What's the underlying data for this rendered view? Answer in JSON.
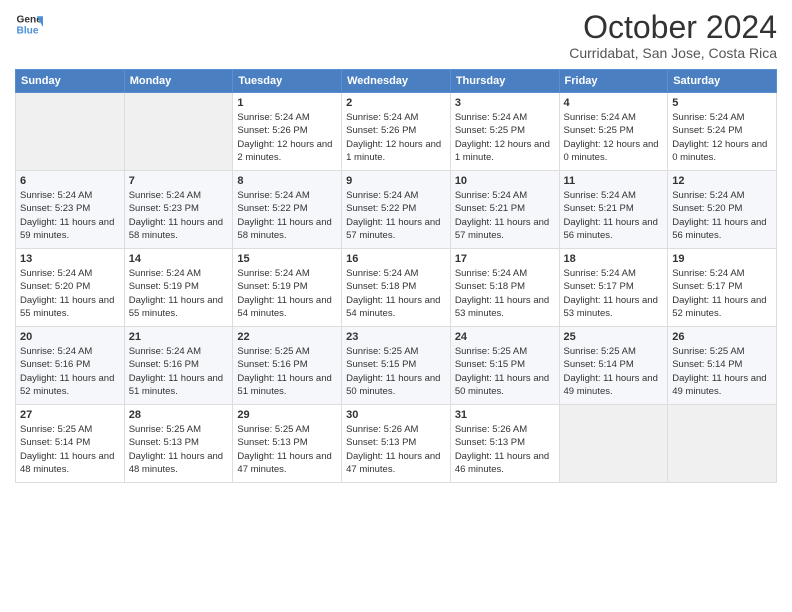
{
  "logo": {
    "line1": "General",
    "line2": "Blue"
  },
  "title": "October 2024",
  "subtitle": "Curridabat, San Jose, Costa Rica",
  "days_of_week": [
    "Sunday",
    "Monday",
    "Tuesday",
    "Wednesday",
    "Thursday",
    "Friday",
    "Saturday"
  ],
  "weeks": [
    [
      {
        "day": "",
        "info": ""
      },
      {
        "day": "",
        "info": ""
      },
      {
        "day": "1",
        "info": "Sunrise: 5:24 AM\nSunset: 5:26 PM\nDaylight: 12 hours and 2 minutes."
      },
      {
        "day": "2",
        "info": "Sunrise: 5:24 AM\nSunset: 5:26 PM\nDaylight: 12 hours and 1 minute."
      },
      {
        "day": "3",
        "info": "Sunrise: 5:24 AM\nSunset: 5:25 PM\nDaylight: 12 hours and 1 minute."
      },
      {
        "day": "4",
        "info": "Sunrise: 5:24 AM\nSunset: 5:25 PM\nDaylight: 12 hours and 0 minutes."
      },
      {
        "day": "5",
        "info": "Sunrise: 5:24 AM\nSunset: 5:24 PM\nDaylight: 12 hours and 0 minutes."
      }
    ],
    [
      {
        "day": "6",
        "info": "Sunrise: 5:24 AM\nSunset: 5:23 PM\nDaylight: 11 hours and 59 minutes."
      },
      {
        "day": "7",
        "info": "Sunrise: 5:24 AM\nSunset: 5:23 PM\nDaylight: 11 hours and 58 minutes."
      },
      {
        "day": "8",
        "info": "Sunrise: 5:24 AM\nSunset: 5:22 PM\nDaylight: 11 hours and 58 minutes."
      },
      {
        "day": "9",
        "info": "Sunrise: 5:24 AM\nSunset: 5:22 PM\nDaylight: 11 hours and 57 minutes."
      },
      {
        "day": "10",
        "info": "Sunrise: 5:24 AM\nSunset: 5:21 PM\nDaylight: 11 hours and 57 minutes."
      },
      {
        "day": "11",
        "info": "Sunrise: 5:24 AM\nSunset: 5:21 PM\nDaylight: 11 hours and 56 minutes."
      },
      {
        "day": "12",
        "info": "Sunrise: 5:24 AM\nSunset: 5:20 PM\nDaylight: 11 hours and 56 minutes."
      }
    ],
    [
      {
        "day": "13",
        "info": "Sunrise: 5:24 AM\nSunset: 5:20 PM\nDaylight: 11 hours and 55 minutes."
      },
      {
        "day": "14",
        "info": "Sunrise: 5:24 AM\nSunset: 5:19 PM\nDaylight: 11 hours and 55 minutes."
      },
      {
        "day": "15",
        "info": "Sunrise: 5:24 AM\nSunset: 5:19 PM\nDaylight: 11 hours and 54 minutes."
      },
      {
        "day": "16",
        "info": "Sunrise: 5:24 AM\nSunset: 5:18 PM\nDaylight: 11 hours and 54 minutes."
      },
      {
        "day": "17",
        "info": "Sunrise: 5:24 AM\nSunset: 5:18 PM\nDaylight: 11 hours and 53 minutes."
      },
      {
        "day": "18",
        "info": "Sunrise: 5:24 AM\nSunset: 5:17 PM\nDaylight: 11 hours and 53 minutes."
      },
      {
        "day": "19",
        "info": "Sunrise: 5:24 AM\nSunset: 5:17 PM\nDaylight: 11 hours and 52 minutes."
      }
    ],
    [
      {
        "day": "20",
        "info": "Sunrise: 5:24 AM\nSunset: 5:16 PM\nDaylight: 11 hours and 52 minutes."
      },
      {
        "day": "21",
        "info": "Sunrise: 5:24 AM\nSunset: 5:16 PM\nDaylight: 11 hours and 51 minutes."
      },
      {
        "day": "22",
        "info": "Sunrise: 5:25 AM\nSunset: 5:16 PM\nDaylight: 11 hours and 51 minutes."
      },
      {
        "day": "23",
        "info": "Sunrise: 5:25 AM\nSunset: 5:15 PM\nDaylight: 11 hours and 50 minutes."
      },
      {
        "day": "24",
        "info": "Sunrise: 5:25 AM\nSunset: 5:15 PM\nDaylight: 11 hours and 50 minutes."
      },
      {
        "day": "25",
        "info": "Sunrise: 5:25 AM\nSunset: 5:14 PM\nDaylight: 11 hours and 49 minutes."
      },
      {
        "day": "26",
        "info": "Sunrise: 5:25 AM\nSunset: 5:14 PM\nDaylight: 11 hours and 49 minutes."
      }
    ],
    [
      {
        "day": "27",
        "info": "Sunrise: 5:25 AM\nSunset: 5:14 PM\nDaylight: 11 hours and 48 minutes."
      },
      {
        "day": "28",
        "info": "Sunrise: 5:25 AM\nSunset: 5:13 PM\nDaylight: 11 hours and 48 minutes."
      },
      {
        "day": "29",
        "info": "Sunrise: 5:25 AM\nSunset: 5:13 PM\nDaylight: 11 hours and 47 minutes."
      },
      {
        "day": "30",
        "info": "Sunrise: 5:26 AM\nSunset: 5:13 PM\nDaylight: 11 hours and 47 minutes."
      },
      {
        "day": "31",
        "info": "Sunrise: 5:26 AM\nSunset: 5:13 PM\nDaylight: 11 hours and 46 minutes."
      },
      {
        "day": "",
        "info": ""
      },
      {
        "day": "",
        "info": ""
      }
    ]
  ]
}
